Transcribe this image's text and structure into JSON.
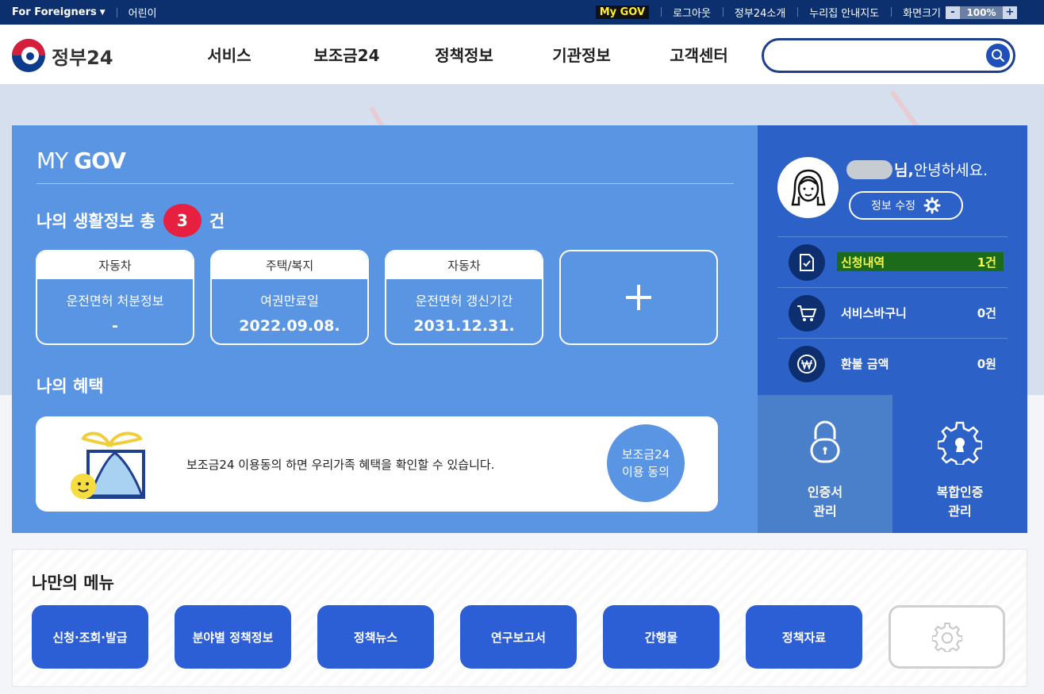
{
  "topbar": {
    "foreigners": "For Foreigners",
    "kids": "어린이",
    "links": [
      "My GOV",
      "로그아웃",
      "정부24소개",
      "누리집 안내지도",
      "화면크기"
    ],
    "zoom_minus": "-",
    "zoom_value": "100%",
    "zoom_plus": "+"
  },
  "header": {
    "logo_text": "정부24",
    "nav": [
      "서비스",
      "보조금24",
      "정책정보",
      "기관정보",
      "고객센터"
    ],
    "search_placeholder": ""
  },
  "mygov": {
    "title_light": "MY ",
    "title_bold": "GOV",
    "life_label": "나의 생활정보 총",
    "life_count": "3",
    "life_unit": "건",
    "cards": [
      {
        "category": "자동차",
        "name": "운전면허 처분정보",
        "value": "-"
      },
      {
        "category": "주택/복지",
        "name": "여권만료일",
        "value": "2022.09.08."
      },
      {
        "category": "자동차",
        "name": "운전면허 갱신기간",
        "value": "2031.12.31."
      }
    ],
    "benefit_title": "나의 혜택",
    "benefit_message": "보조금24 이용동의 하면 우리가족 혜택을 확인할 수 있습니다.",
    "agree_line1": "보조금24",
    "agree_line2": "이용 동의"
  },
  "user": {
    "greeting_suffix": "님,",
    "greeting_rest": " 안녕하세요.",
    "edit_label": "정보 수정",
    "rows": [
      {
        "label": "신청내역",
        "value": "1건",
        "icon": "document-check-icon"
      },
      {
        "label": "서비스바구니",
        "value": "0건",
        "icon": "cart-icon"
      },
      {
        "label": "환불 금액",
        "value": "0원",
        "icon": "won-icon"
      }
    ],
    "cert_line1": "인증서",
    "cert_line2": "관리",
    "multi_line1": "복합인증",
    "multi_line2": "관리"
  },
  "mymenu": {
    "title": "나만의 메뉴",
    "items": [
      "신청·조회·발급",
      "분야별 정책정보",
      "정책뉴스",
      "연구보고서",
      "간행물",
      "정책자료"
    ]
  },
  "colors": {
    "topbar": "#0c2f6e",
    "panel_blue": "#5a95e3",
    "user_blue": "#2c61c8",
    "badge_red": "#e8203f",
    "menu_button": "#2c5fd6"
  }
}
